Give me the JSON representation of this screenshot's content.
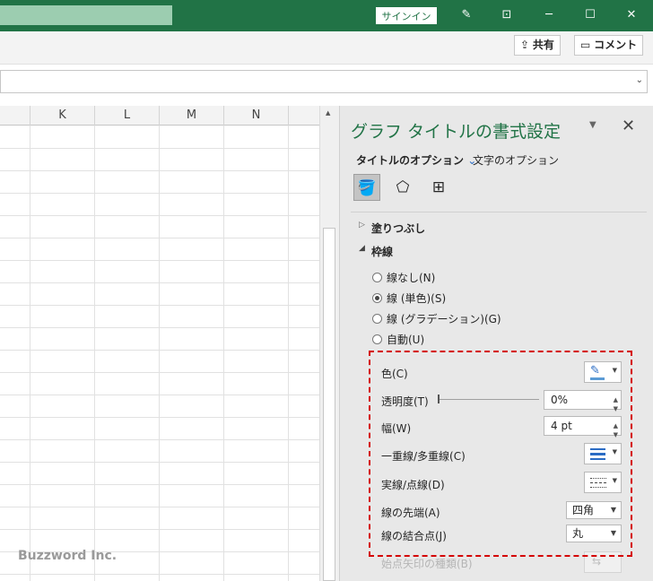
{
  "titlebar": {
    "signin_label": "サインイン",
    "pen_icon": "pen-icon",
    "ribbon_display_icon": "ribbon-display-icon"
  },
  "ribbon": {
    "share_label": "共有",
    "comment_label": "コメント"
  },
  "columns": [
    "K",
    "L",
    "M",
    "N",
    "("
  ],
  "pane": {
    "title": "グラフ タイトルの書式設定",
    "tabs": {
      "title_options": "タイトルのオプション",
      "text_options": "文字のオプション"
    },
    "sections": {
      "fill": "塗りつぶし",
      "line": "枠線"
    },
    "line_options": [
      "線なし(N)",
      "線 (単色)(S)",
      "線 (グラデーション)(G)",
      "自動(U)"
    ],
    "selected_line_option": "線 (単色)(S)",
    "props": {
      "color_label": "色(C)",
      "transparency_label": "透明度(T)",
      "transparency_value": "0%",
      "width_label": "幅(W)",
      "width_value": "4 pt",
      "compound_label": "一重線/多重線(C)",
      "dash_label": "実線/点線(D)",
      "cap_label": "線の先端(A)",
      "cap_value": "四角",
      "join_label": "線の結合点(J)",
      "join_value": "丸",
      "arrow_label": "始点矢印の種類(B)"
    }
  },
  "watermark": "Buzzword Inc.",
  "colors": {
    "excel_green": "#217346",
    "highlight_red": "#d40000"
  }
}
